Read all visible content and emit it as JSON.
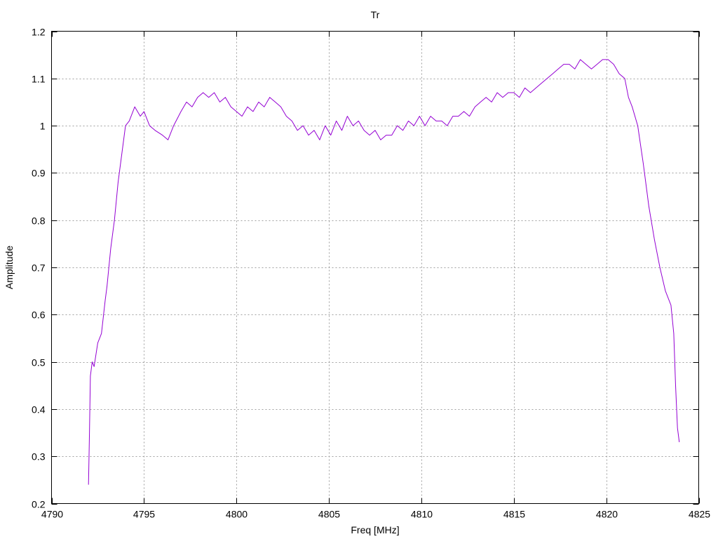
{
  "chart_data": {
    "type": "line",
    "title": "Tr",
    "xlabel": "Freq [MHz]",
    "ylabel": "Amplitude",
    "xlim": [
      4790,
      4825
    ],
    "ylim": [
      0.2,
      1.2
    ],
    "xticks": [
      4790,
      4795,
      4800,
      4805,
      4810,
      4815,
      4820,
      4825
    ],
    "yticks": [
      0.2,
      0.3,
      0.4,
      0.5,
      0.6,
      0.7,
      0.8,
      0.9,
      1.0,
      1.1,
      1.2
    ],
    "ytick_labels": [
      "0.2",
      "0.3",
      "0.4",
      "0.5",
      "0.6",
      "0.7",
      "0.8",
      "0.9",
      "1",
      "1.1",
      "1.2"
    ],
    "grid": true,
    "color": "#9400d3",
    "series": [
      {
        "x": [
          4792.0,
          4792.05,
          4792.1,
          4792.2,
          4792.3,
          4792.5,
          4792.7,
          4792.9,
          4793.0,
          4793.2,
          4793.4,
          4793.6,
          4793.8,
          4794.0,
          4794.2,
          4794.5,
          4794.8,
          4795.0,
          4795.3,
          4795.6,
          4796.0,
          4796.3,
          4796.6,
          4797.0,
          4797.3,
          4797.6,
          4797.9,
          4798.2,
          4798.5,
          4798.8,
          4799.1,
          4799.4,
          4799.7,
          4800.0,
          4800.3,
          4800.6,
          4800.9,
          4801.2,
          4801.5,
          4801.8,
          4802.1,
          4802.4,
          4802.7,
          4803.0,
          4803.3,
          4803.6,
          4803.9,
          4804.2,
          4804.5,
          4804.8,
          4805.1,
          4805.4,
          4805.7,
          4806.0,
          4806.3,
          4806.6,
          4806.9,
          4807.2,
          4807.5,
          4807.8,
          4808.1,
          4808.4,
          4808.7,
          4809.0,
          4809.3,
          4809.6,
          4809.9,
          4810.2,
          4810.5,
          4810.8,
          4811.1,
          4811.4,
          4811.7,
          4812.0,
          4812.3,
          4812.6,
          4812.9,
          4813.2,
          4813.5,
          4813.8,
          4814.1,
          4814.4,
          4814.7,
          4815.0,
          4815.3,
          4815.6,
          4815.9,
          4816.2,
          4816.5,
          4816.8,
          4817.1,
          4817.4,
          4817.7,
          4818.0,
          4818.3,
          4818.6,
          4818.9,
          4819.2,
          4819.5,
          4819.8,
          4820.1,
          4820.4,
          4820.7,
          4821.0,
          4821.2,
          4821.4,
          4821.7,
          4822.0,
          4822.3,
          4822.6,
          4822.9,
          4823.2,
          4823.5,
          4823.65,
          4823.75,
          4823.85,
          4823.95
        ],
        "y": [
          0.24,
          0.35,
          0.47,
          0.5,
          0.49,
          0.54,
          0.56,
          0.63,
          0.66,
          0.74,
          0.8,
          0.88,
          0.94,
          1.0,
          1.01,
          1.04,
          1.02,
          1.03,
          1.0,
          0.99,
          0.98,
          0.97,
          1.0,
          1.03,
          1.05,
          1.04,
          1.06,
          1.07,
          1.06,
          1.07,
          1.05,
          1.06,
          1.04,
          1.03,
          1.02,
          1.04,
          1.03,
          1.05,
          1.04,
          1.06,
          1.05,
          1.04,
          1.02,
          1.01,
          0.99,
          1.0,
          0.98,
          0.99,
          0.97,
          1.0,
          0.98,
          1.01,
          0.99,
          1.02,
          1.0,
          1.01,
          0.99,
          0.98,
          0.99,
          0.97,
          0.98,
          0.98,
          1.0,
          0.99,
          1.01,
          1.0,
          1.02,
          1.0,
          1.02,
          1.01,
          1.01,
          1.0,
          1.02,
          1.02,
          1.03,
          1.02,
          1.04,
          1.05,
          1.06,
          1.05,
          1.07,
          1.06,
          1.07,
          1.07,
          1.06,
          1.08,
          1.07,
          1.08,
          1.09,
          1.1,
          1.11,
          1.12,
          1.13,
          1.13,
          1.12,
          1.14,
          1.13,
          1.12,
          1.13,
          1.14,
          1.14,
          1.13,
          1.11,
          1.1,
          1.06,
          1.04,
          1.0,
          0.92,
          0.83,
          0.76,
          0.7,
          0.65,
          0.62,
          0.56,
          0.45,
          0.36,
          0.33
        ]
      }
    ]
  }
}
